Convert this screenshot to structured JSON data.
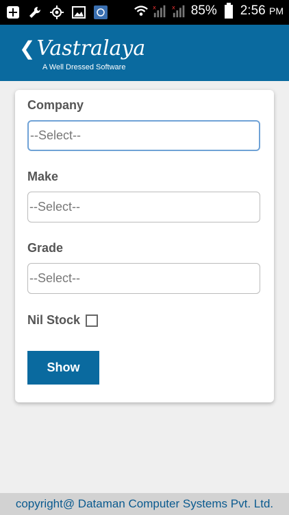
{
  "status_bar": {
    "battery": "85%",
    "time": "2:56",
    "ampm": "PM"
  },
  "header": {
    "logo_text": "Vastralaya",
    "tagline": "A Well Dressed Software"
  },
  "form": {
    "company_label": "Company",
    "company_value": "--Select--",
    "make_label": "Make",
    "make_value": "--Select--",
    "grade_label": "Grade",
    "grade_value": "--Select--",
    "nil_stock_label": "Nil Stock",
    "show_label": "Show"
  },
  "footer": {
    "copyright": "copyright@ Dataman Computer Systems Pvt. Ltd."
  },
  "colors": {
    "brand_blue": "#0a6a9f",
    "footer_text": "#0a5a8f"
  }
}
